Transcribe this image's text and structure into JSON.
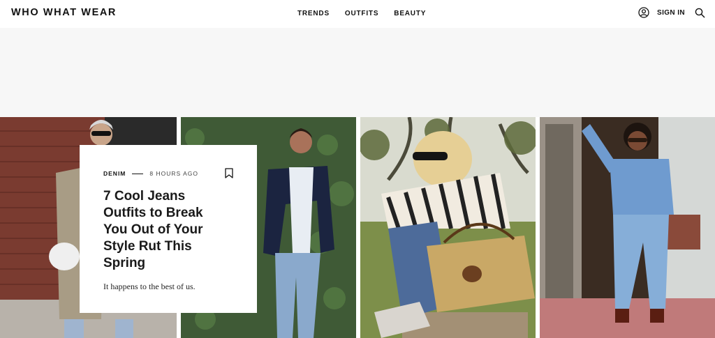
{
  "header": {
    "logo": "WHO WHAT WEAR",
    "nav": [
      "TRENDS",
      "OUTFITS",
      "BEAUTY"
    ],
    "sign_in": "SIGN IN",
    "icons": {
      "account": "user-circle-icon",
      "search": "search-icon",
      "bookmark": "bookmark-icon"
    }
  },
  "article": {
    "category": "DENIM",
    "time": "8 HOURS AGO",
    "headline": "7 Cool Jeans Outfits to Break You Out of Your Style Rut This Spring",
    "dek": "It happens to the best of us."
  },
  "colors": {
    "text": "#111111",
    "ad_band": "#f7f7f7",
    "background": "#ffffff"
  }
}
